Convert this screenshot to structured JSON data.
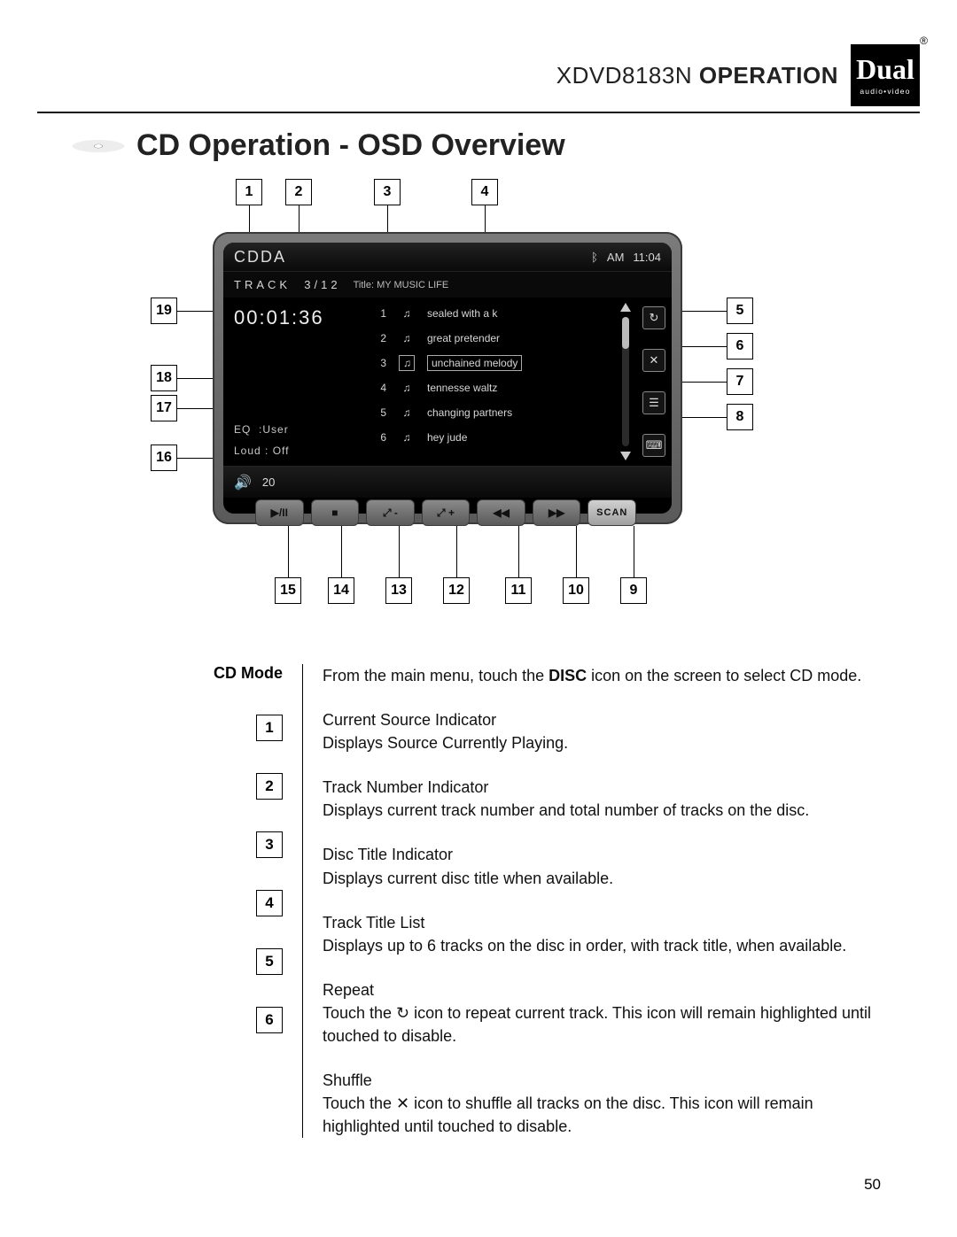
{
  "header": {
    "model": "XDVD8183N",
    "word": "OPERATION",
    "logo_main": "Dual",
    "logo_sub": "audio•video"
  },
  "section_title": "CD Operation - OSD Overview",
  "osd": {
    "source_badge": "CDDA",
    "clock_prefix": "AM",
    "clock": "11:04",
    "track_label": "TRACK",
    "track_value": "3/12",
    "disc_title_label": "Title:",
    "disc_title": "MY  MUSIC LIFE",
    "elapsed": "00:01:36",
    "eq_label": "EQ",
    "eq_value": ":User",
    "loud_label": "Loud",
    "loud_value": ": Off",
    "volume": "20",
    "tracks": [
      {
        "n": "1",
        "title": "sealed with a k"
      },
      {
        "n": "2",
        "title": "great pretender"
      },
      {
        "n": "3",
        "title": "unchained melody"
      },
      {
        "n": "4",
        "title": "tennesse waltz"
      },
      {
        "n": "5",
        "title": "changing partners"
      },
      {
        "n": "6",
        "title": "hey jude"
      }
    ],
    "side": {
      "repeat": "↻",
      "shuffle": "✕",
      "list": "☰",
      "keyboard": "⌨"
    },
    "ctrl": {
      "play": "▶/II",
      "stop": "■",
      "zoom_out": "⤢ -",
      "zoom_in": "⤢ +",
      "rew": "◀◀",
      "fwd": "▶▶",
      "scan": "SCAN"
    }
  },
  "callouts_top": [
    "1",
    "2",
    "3",
    "4"
  ],
  "callouts_right": [
    "5",
    "6",
    "7",
    "8"
  ],
  "callouts_left": [
    "19",
    "18",
    "17",
    "16"
  ],
  "callouts_bottom": [
    "15",
    "14",
    "13",
    "12",
    "11",
    "10",
    "9"
  ],
  "legend": {
    "mode_label": "CD Mode",
    "intro_pre": "From the main menu, touch the ",
    "intro_bold": "DISC",
    "intro_post": " icon on the screen to select CD mode.",
    "items": [
      {
        "n": "1",
        "t": "Current Source Indicator",
        "d": "Displays Source Currently Playing."
      },
      {
        "n": "2",
        "t": "Track Number Indicator",
        "d": "Displays current track number and total number of tracks on the disc."
      },
      {
        "n": "3",
        "t": "Disc Title Indicator",
        "d": "Displays current disc title when available."
      },
      {
        "n": "4",
        "t": "Track Title List",
        "d": "Displays up to 6 tracks on the disc in order, with track title, when available."
      },
      {
        "n": "5",
        "t": "Repeat",
        "d": "Touch the ↻ icon to repeat current track. This icon will remain highlighted until touched to disable."
      },
      {
        "n": "6",
        "t": "Shuffle",
        "d": "Touch the ✕ icon to shuffle all tracks on the disc. This icon will remain highlighted until touched to disable."
      }
    ]
  },
  "page_number": "50"
}
